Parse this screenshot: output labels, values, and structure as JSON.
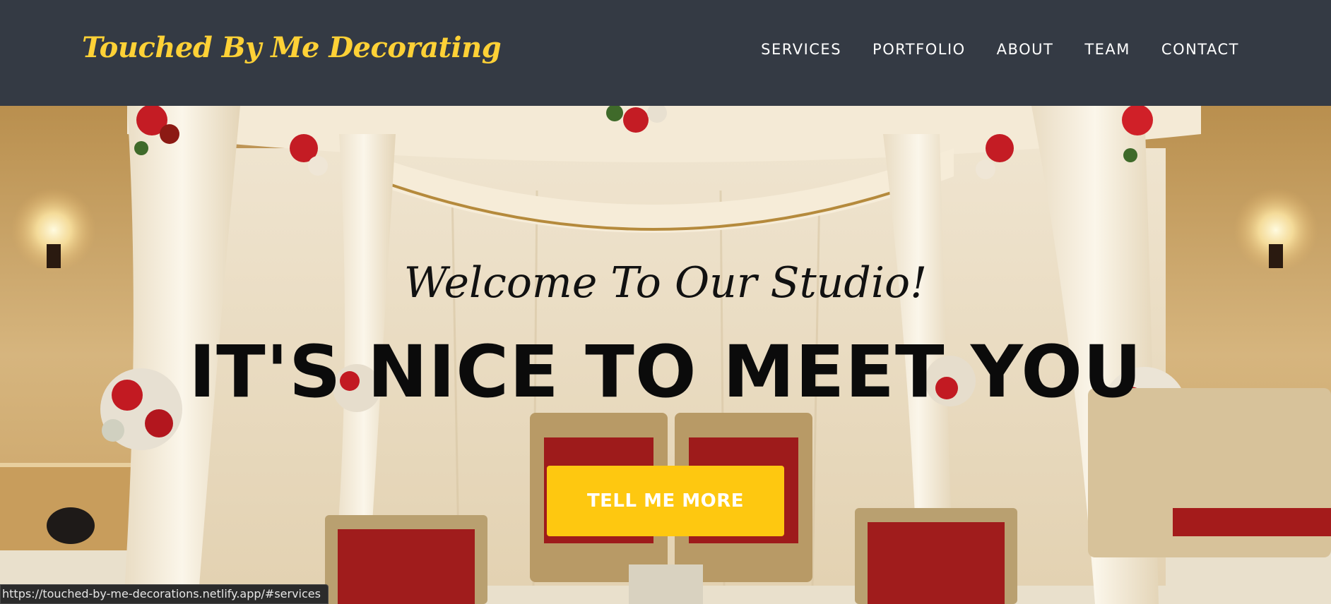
{
  "brand": {
    "name": "Touched By Me Decorating",
    "color": "#fed136"
  },
  "nav": {
    "items": [
      {
        "label": "SERVICES"
      },
      {
        "label": "PORTFOLIO"
      },
      {
        "label": "ABOUT"
      },
      {
        "label": "TEAM"
      },
      {
        "label": "CONTACT"
      }
    ]
  },
  "hero": {
    "subheading": "Welcome To Our Studio!",
    "heading": "IT'S NICE TO MEET YOU",
    "cta_label": "TELL ME MORE",
    "background_image": "wedding-mandap-decor",
    "accent_color": "#fec810"
  },
  "status_bar": {
    "url": "https://touched-by-me-decorations.netlify.app/#services"
  },
  "colors": {
    "navbar": "#343a44",
    "text_light": "#ffffff",
    "text_dark": "#0b0b0b"
  }
}
